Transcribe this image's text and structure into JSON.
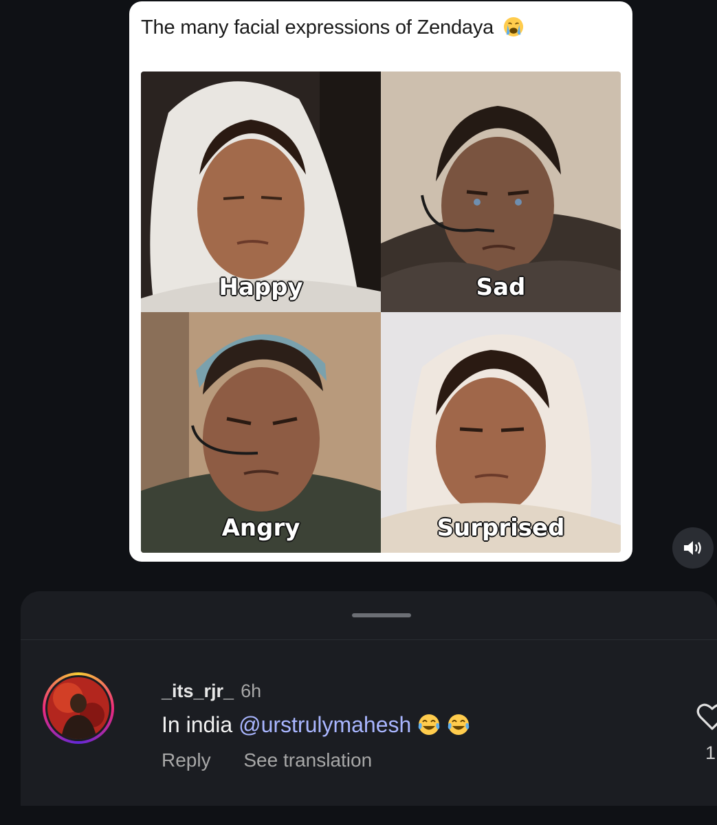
{
  "post": {
    "caption": "The many facial expressions of Zendaya",
    "caption_emoji": "loudly-crying-face-emoji",
    "panels": [
      {
        "label": "Happy"
      },
      {
        "label": "Sad"
      },
      {
        "label": "Angry"
      },
      {
        "label": "Surprised"
      }
    ]
  },
  "controls": {
    "sound_icon": "speaker-on-icon"
  },
  "comment": {
    "username": "_its_rjr_",
    "time": "6h",
    "text_prefix": "In india ",
    "mention": "@urstrulymahesh",
    "emojis": [
      "face-with-tears-of-joy-emoji",
      "face-with-tears-of-joy-emoji"
    ],
    "reply_label": "Reply",
    "translate_label": "See translation",
    "like_count": "1"
  },
  "colors": {
    "background": "#0f1115",
    "sheet": "#1b1d22",
    "mention": "#a9b6ff",
    "secondary_text": "#a8a8a8"
  }
}
